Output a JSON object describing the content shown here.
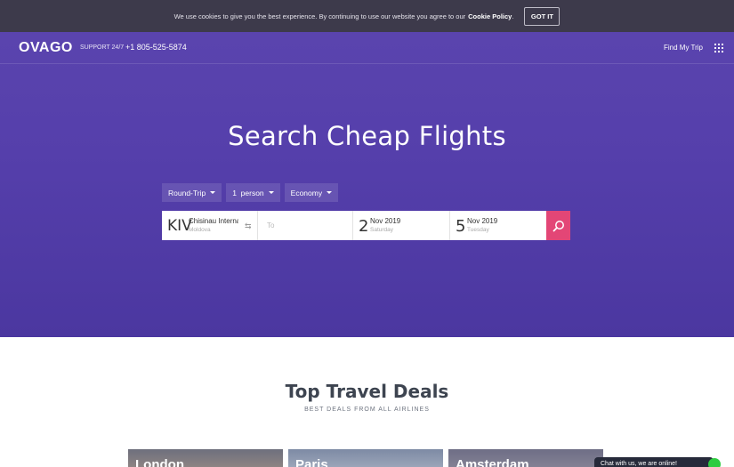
{
  "cookie": {
    "text": "We use cookies to give you the best experience. By continuing to use our website you agree to our",
    "link": "Cookie Policy",
    "period": ".",
    "button": "GOT IT"
  },
  "header": {
    "logo": "OVAGO",
    "support_label": "SUPPORT 24/7",
    "phone": "+1 805-525-5874",
    "find_my_trip": "Find My Trip",
    "menu_icon": "grid-icon"
  },
  "hero": {
    "title": "Search Cheap Flights"
  },
  "search": {
    "trip_type": "Round-Trip",
    "passengers": "1  person",
    "cabin": "Economy",
    "from": {
      "code": "KIV",
      "city": "Chisinau International",
      "country": "Moldova"
    },
    "to_placeholder": "To",
    "departure": {
      "day": "2",
      "month": "Nov 2019",
      "weekday": "Saturday"
    },
    "return": {
      "day": "5",
      "month": "Nov 2019",
      "weekday": "Tuesday"
    },
    "search_icon": "search-icon",
    "swap_icon": "swap-icon"
  },
  "deals": {
    "title": "Top Travel Deals",
    "subtitle": "BEST DEALS FROM ALL AIRLINES",
    "cards": [
      {
        "city": "London"
      },
      {
        "city": "Paris"
      },
      {
        "city": "Amsterdam"
      }
    ]
  },
  "chat": {
    "text": "Chat with us, we are online!"
  },
  "colors": {
    "hero": "#553fab",
    "accent": "#e34676",
    "cookie_bar": "#3d3a4b",
    "chat_online": "#2ecc40"
  }
}
